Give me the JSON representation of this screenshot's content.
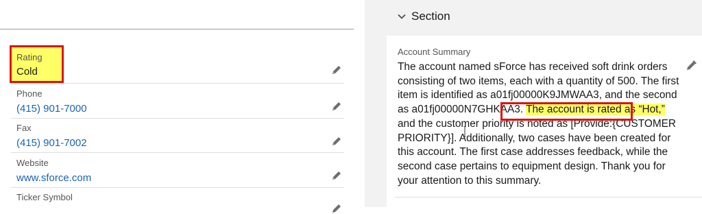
{
  "left_fields": {
    "rating": {
      "label": "Rating",
      "value": "Cold"
    },
    "phone": {
      "label": "Phone",
      "value": "(415) 901-7000"
    },
    "fax": {
      "label": "Fax",
      "value": "(415) 901-7002"
    },
    "website": {
      "label": "Website",
      "value": "www.sforce.com"
    },
    "ticker": {
      "label": "Ticker Symbol",
      "value": ""
    }
  },
  "section": {
    "title": "Section",
    "summary_label": "Account Summary",
    "summary_before": "The account named sForce has received soft drink orders consisting of two items, each with a quantity of 500. The first item is identified as a01fj00000K9JMWAA3, and the second as a01fj00000N7GHKAA3. ",
    "summary_highlight": "The account is rated as “Hot,”",
    "summary_after": " and the customer priority is noted as [Provide:{CUSTOMER PRIORITY}]. Additionally, two cases have been created for this account. The first case addresses feedback, while the second case pertains to equipment design. Thank you for your attention to this summary."
  },
  "colors": {
    "highlight_yellow": "#ffff66",
    "annotation_red": "#e0120f",
    "link_blue": "#1a63b8"
  },
  "icons": [
    "pencil-icon",
    "chevron-down-icon",
    "text-cursor-icon"
  ]
}
